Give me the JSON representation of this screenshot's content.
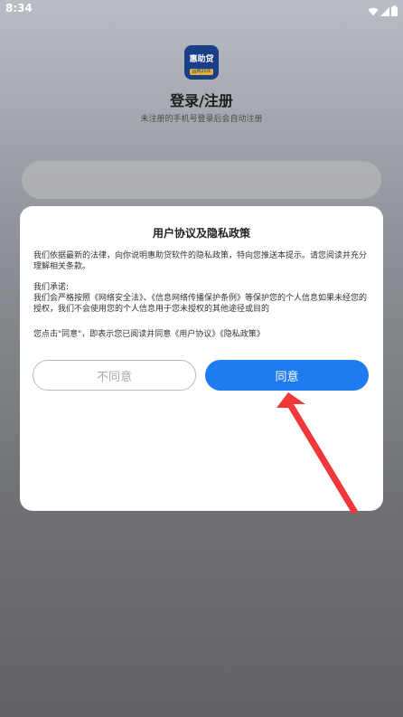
{
  "status_bar": {
    "time": "8:34",
    "icons": [
      "wifi-icon",
      "signal-icon",
      "battery-icon"
    ]
  },
  "app": {
    "logo_text": "惠助贷",
    "logo_sub": "品牌20年",
    "title": "登录/注册",
    "subtitle": "未注册的手机号登录后会自动注册"
  },
  "dialog": {
    "title": "用户协议及隐私政策",
    "intro": "我们依据最新的法律，向你说明惠助贷软件的隐私政策，特向您推送本提示。请您阅读并充分理解相关条款。",
    "promise_heading": "我们承诺:",
    "promise_text": "我们会严格按照《网络安全法》、《信息网络传播保护条例》等保护您的个人信息如果未经您的授权，我们不会使用您的个人信息用于您未授权的其他途径或目的",
    "consent_text": "您点击\"同意\"，即表示您已阅读并同意《用户协议》《隐私政策》",
    "disagree_label": "不同意",
    "agree_label": "同意"
  },
  "colors": {
    "accent": "#1f7bf2",
    "annotation_arrow": "#f0373a"
  }
}
